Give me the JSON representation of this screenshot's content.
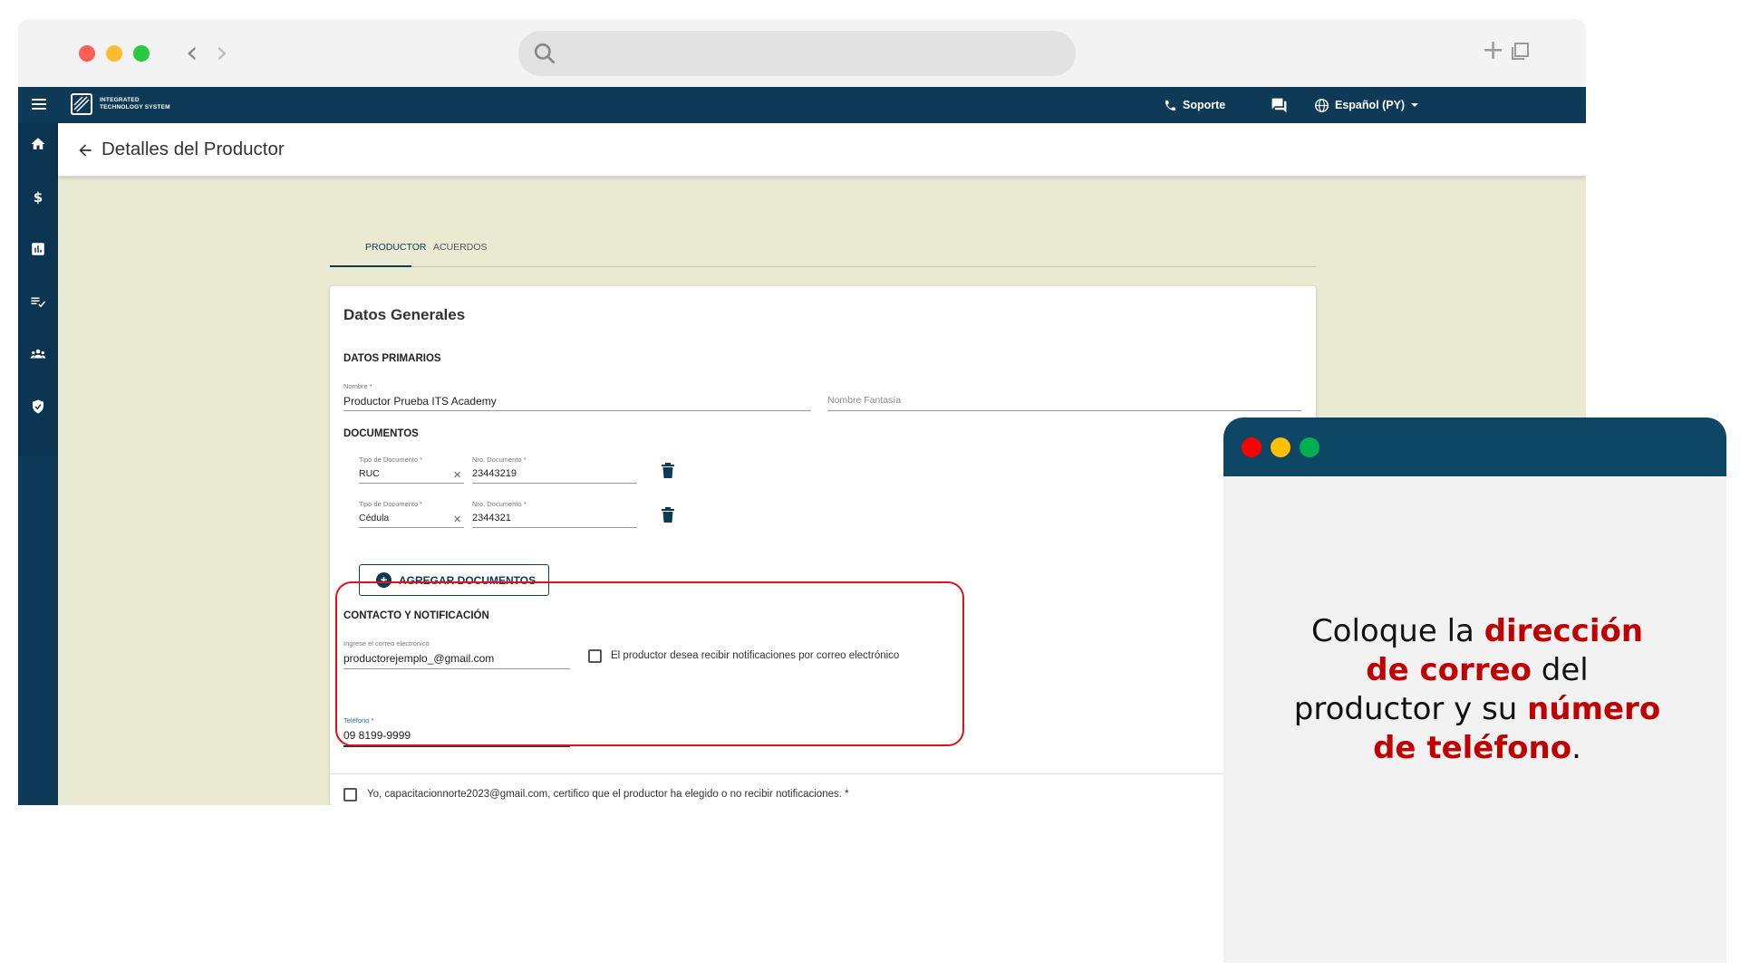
{
  "browser": {
    "url": ""
  },
  "app": {
    "brand_line1": "INTEGRATED",
    "brand_line2": "TECHNOLOGY SYSTEM",
    "support_label": "Soporte",
    "language_label": "Español (PY)"
  },
  "page": {
    "title": "Detalles del Productor"
  },
  "tabs": [
    {
      "label": "PRODUCTOR",
      "active": true
    },
    {
      "label": "ACUERDOS",
      "active": false
    }
  ],
  "card": {
    "title": "Datos Generales",
    "primary_section": "DATOS PRIMARIOS",
    "name_label": "Nombre *",
    "name_value": "Productor Prueba ITS Academy",
    "fantasy_placeholder": "Nombre Fantasía",
    "documents_section": "DOCUMENTOS",
    "documents": [
      {
        "type_label": "Tipo de Documento *",
        "type_value": "RUC",
        "number_label": "Nro. Documento *",
        "number_value": "23443219"
      },
      {
        "type_label": "Tipo de Documento *",
        "type_value": "Cédula",
        "number_label": "Nro. Documento *",
        "number_value": "2344321"
      }
    ],
    "add_documents_label": "AGREGAR DOCUMENTOS",
    "contact_section": "CONTACTO Y NOTIFICACIÓN",
    "email_label": "Ingrese el correo electrónico",
    "email_value": "productorejemplo_@gmail.com",
    "email_notify_label": "El productor desea recibir notificaciones por correo electrónico",
    "phone_label": "Teléfono *",
    "phone_value": "09 8199-9999",
    "certify_label": "Yo, capacitacionnorte2023@gmail.com, certifico que el productor ha elegido o no recibir notificaciones. *"
  },
  "callout": {
    "part1": "Coloque la ",
    "highlight1": "dirección de correo",
    "part2": " del productor y su ",
    "highlight2": "número de teléfono",
    "part3": "."
  },
  "colors": {
    "navy": "#0e3a57",
    "content_bg": "#eae9d2",
    "highlight_red": "#e0101c",
    "callout_red": "#c00000"
  }
}
